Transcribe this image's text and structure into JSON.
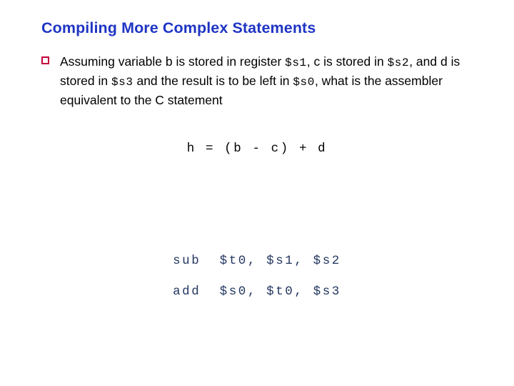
{
  "slide": {
    "title": "Compiling More Complex Statements",
    "title_color": "#1f35c4",
    "background_color": "#ffffff",
    "bullet": {
      "marker": "hollow-square-bullet",
      "marker_color": "#c4003c",
      "text_color": "#000000",
      "segments": [
        {
          "type": "text",
          "value": "Assuming variable b is stored in register "
        },
        {
          "type": "mono",
          "value": "$s1"
        },
        {
          "type": "text",
          "value": ", c is stored in "
        },
        {
          "type": "mono",
          "value": "$s2"
        },
        {
          "type": "text",
          "value": ", and d is stored in "
        },
        {
          "type": "mono",
          "value": "$s3"
        },
        {
          "type": "text",
          "value": " and the result is to be left in "
        },
        {
          "type": "mono",
          "value": "$s0"
        },
        {
          "type": "text",
          "value": ", what is the assembler equivalent to the C statement"
        }
      ],
      "lines": [
        "Assuming variable b is stored in register $s1, c is",
        "stored in $s2, and d is stored in $s3 and the result is",
        "to be left in $s0, what is the assembler equivalent to",
        "the C statement"
      ],
      "part1": "Assuming variable b is stored in register ",
      "reg1": "$s1",
      "part2": ", c is stored in ",
      "reg2": "$s2",
      "part3": ", and d is stored in ",
      "reg3": "$s3",
      "part4": " and the result is to be left in ",
      "reg4": "$s0",
      "part5": ", what is the assembler equivalent to the C statement"
    },
    "c_statement": "h = (b - c) + d",
    "assembly": {
      "color": "#23365f",
      "lines": [
        "sub  $t0, $s1, $s2",
        "add  $s0, $t0, $s3"
      ],
      "line1": "sub  $t0, $s1, $s2",
      "line2": "add  $s0, $t0, $s3"
    }
  }
}
